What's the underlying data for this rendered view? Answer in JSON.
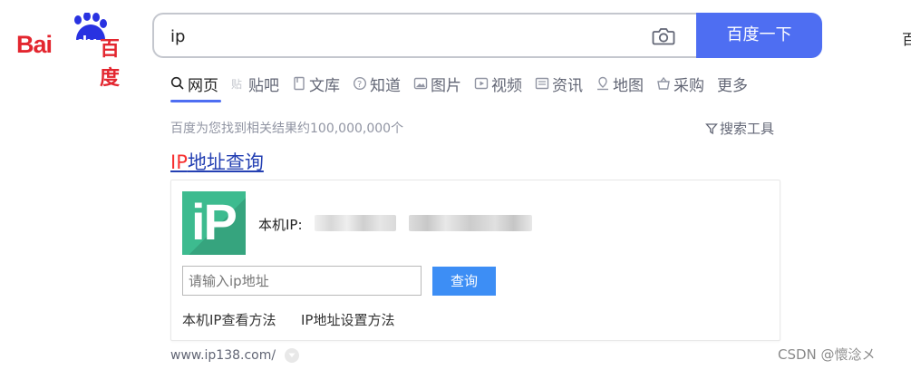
{
  "logo": {
    "bai": "Bai",
    "du": "du",
    "cn": "百度"
  },
  "search": {
    "value": "ip",
    "button_label": "百度一下"
  },
  "edge_text": "百",
  "tabs": [
    {
      "label": "网页",
      "icon": "search-icon",
      "active": true
    },
    {
      "label": "贴吧",
      "icon": "tieba-icon"
    },
    {
      "label": "文库",
      "icon": "doc-icon"
    },
    {
      "label": "知道",
      "icon": "question-icon"
    },
    {
      "label": "图片",
      "icon": "image-icon"
    },
    {
      "label": "视频",
      "icon": "video-icon"
    },
    {
      "label": "资讯",
      "icon": "news-icon"
    },
    {
      "label": "地图",
      "icon": "map-icon"
    },
    {
      "label": "采购",
      "icon": "basket-icon"
    },
    {
      "label": "更多"
    }
  ],
  "results": {
    "count_text": "百度为您找到相关结果约100,000,000个",
    "tools_label": "搜索工具"
  },
  "result": {
    "title_highlight": "IP",
    "title_rest": "地址查询",
    "logo_text": "iP",
    "ip_label": "本机IP:",
    "input_placeholder": "请输入ip地址",
    "query_button": "查询",
    "link1": "本机IP查看方法",
    "link2": "IP地址设置方法",
    "url": "www.ip138.com/"
  },
  "watermark": "CSDN @懷淰メ",
  "colors": {
    "accent": "#4e6ef2",
    "logo_red": "#e3262f",
    "link_blue": "#2440b3",
    "highlight_red": "#f73131",
    "ip_green": "#3dbb8f"
  }
}
